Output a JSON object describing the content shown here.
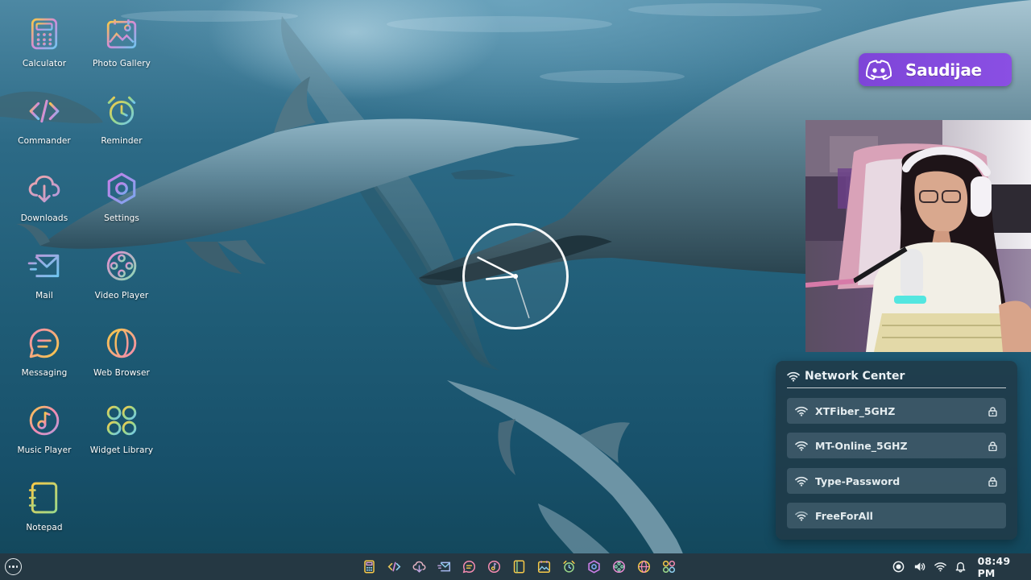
{
  "desktop": {
    "apps": [
      {
        "label": "Calculator",
        "icon": "calculator-icon"
      },
      {
        "label": "Photo Gallery",
        "icon": "photo-gallery-icon"
      },
      {
        "label": "Commander",
        "icon": "code-icon"
      },
      {
        "label": "Reminder",
        "icon": "alarm-clock-icon"
      },
      {
        "label": "Downloads",
        "icon": "cloud-download-icon"
      },
      {
        "label": "Settings",
        "icon": "gear-hexagon-icon"
      },
      {
        "label": "Mail",
        "icon": "mail-icon"
      },
      {
        "label": "Video Player",
        "icon": "film-reel-icon"
      },
      {
        "label": "Messaging",
        "icon": "chat-bubble-icon"
      },
      {
        "label": "Web Browser",
        "icon": "globe-icon"
      },
      {
        "label": "Music Player",
        "icon": "music-disc-icon"
      },
      {
        "label": "Widget Library",
        "icon": "widget-grid-icon"
      },
      {
        "label": "Notepad",
        "icon": "notepad-icon"
      }
    ]
  },
  "clock": {
    "hours": 8,
    "minutes": 49,
    "seconds": 27
  },
  "discord": {
    "username": "Saudijae",
    "icon": "discord-logo-icon",
    "color": "#8248dc"
  },
  "network_center": {
    "title": "Network Center",
    "networks": [
      {
        "ssid": "XTFiber_5GHZ",
        "secured": true
      },
      {
        "ssid": "MT-Online_5GHZ",
        "secured": true
      },
      {
        "ssid": "Type-Password",
        "secured": true
      },
      {
        "ssid": "FreeForAll",
        "secured": false
      }
    ]
  },
  "taskbar": {
    "start_icon": "more-dots-icon",
    "apps": [
      "calculator-icon",
      "code-icon",
      "cloud-download-icon",
      "mail-icon",
      "chat-bubble-icon",
      "music-disc-icon",
      "notepad-icon",
      "photo-gallery-icon",
      "alarm-clock-icon",
      "gear-hexagon-icon",
      "film-reel-icon",
      "globe-icon",
      "widget-grid-icon"
    ],
    "tray": [
      "record-icon",
      "volume-icon",
      "wifi-icon",
      "bell-icon"
    ],
    "time": "08:49 PM"
  },
  "colors": {
    "taskbar": "#253843",
    "panel": "#203a48",
    "accent_gradient_start": "#f7c948",
    "accent_gradient_end": "#6fc6f0"
  }
}
